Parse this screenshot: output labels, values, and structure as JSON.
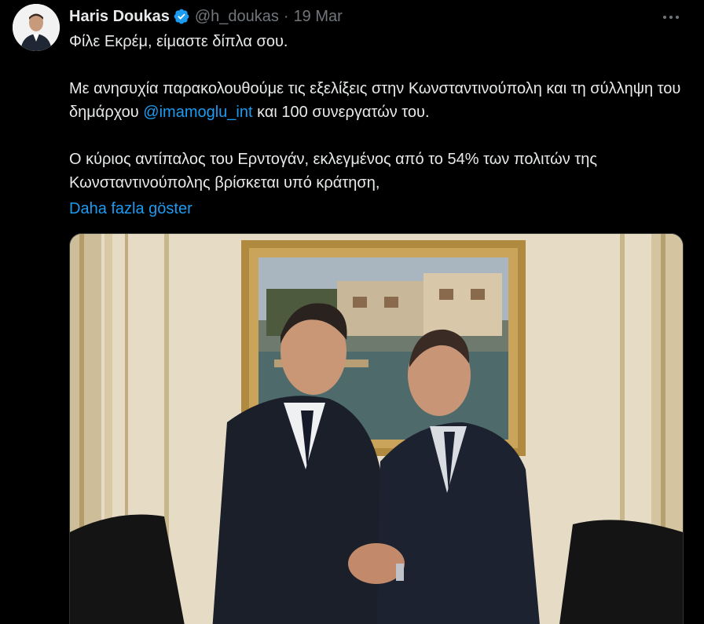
{
  "author": {
    "display_name": "Haris Doukas",
    "handle": "@h_doukas",
    "separator": "·",
    "timestamp": "19 Mar",
    "verified_icon": "verified-badge-icon",
    "verified_color": "#1d9bf0"
  },
  "tweet": {
    "line1": "Φίλε Εκρέμ, είμαστε δίπλα σου.",
    "para2_before": "Με ανησυχία παρακολουθούμε τις εξελίξεις στην Κωνσταντινούπολη και τη σύλληψη του δημάρχου ",
    "mention": "@imamoglu_int",
    "para2_after": " και 100 συνεργατών του.",
    "para3": "Ο κύριος αντίπαλος του Ερντογάν, εκλεγμένος από το 54% των πολιτών της Κωνσταντινούπολης βρίσκεται υπό κράτηση,",
    "show_more": "Daha fazla göster"
  },
  "menu": {
    "icon": "more-options-icon"
  },
  "colors": {
    "background": "#000000",
    "text": "#e7e9ea",
    "muted": "#71767b",
    "link": "#1d9bf0"
  }
}
